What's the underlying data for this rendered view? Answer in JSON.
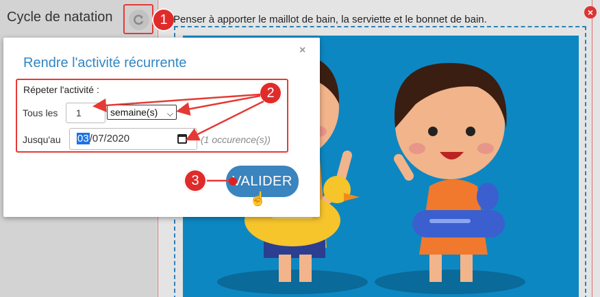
{
  "page": {
    "title": "Cycle de natation",
    "description": "Penser à apporter le maillot de bain, la serviette et le bonnet de bain."
  },
  "annotations": {
    "badge1": "1",
    "badge2": "2",
    "badge3": "3"
  },
  "popup": {
    "title": "Rendre l'activité récurrente",
    "close_icon": "×",
    "repeat_label": "Répeter l'activité :",
    "every_label": "Tous les",
    "count_value": "1",
    "unit_selected": "semaine(s)",
    "until_label": "Jusqu'au",
    "date_day": "03",
    "date_rest": "/07/2020",
    "occurrences": "(1 occurence(s))",
    "submit_label": "VALIDER"
  },
  "colors": {
    "accent": "#2f86c4",
    "button": "#3a84bf",
    "annotation": "#e53935"
  },
  "icons": {
    "recurrence": "recurrence-icon",
    "calendar": "calendar-icon",
    "close": "close-icon",
    "cursor": "hand-cursor-icon"
  }
}
